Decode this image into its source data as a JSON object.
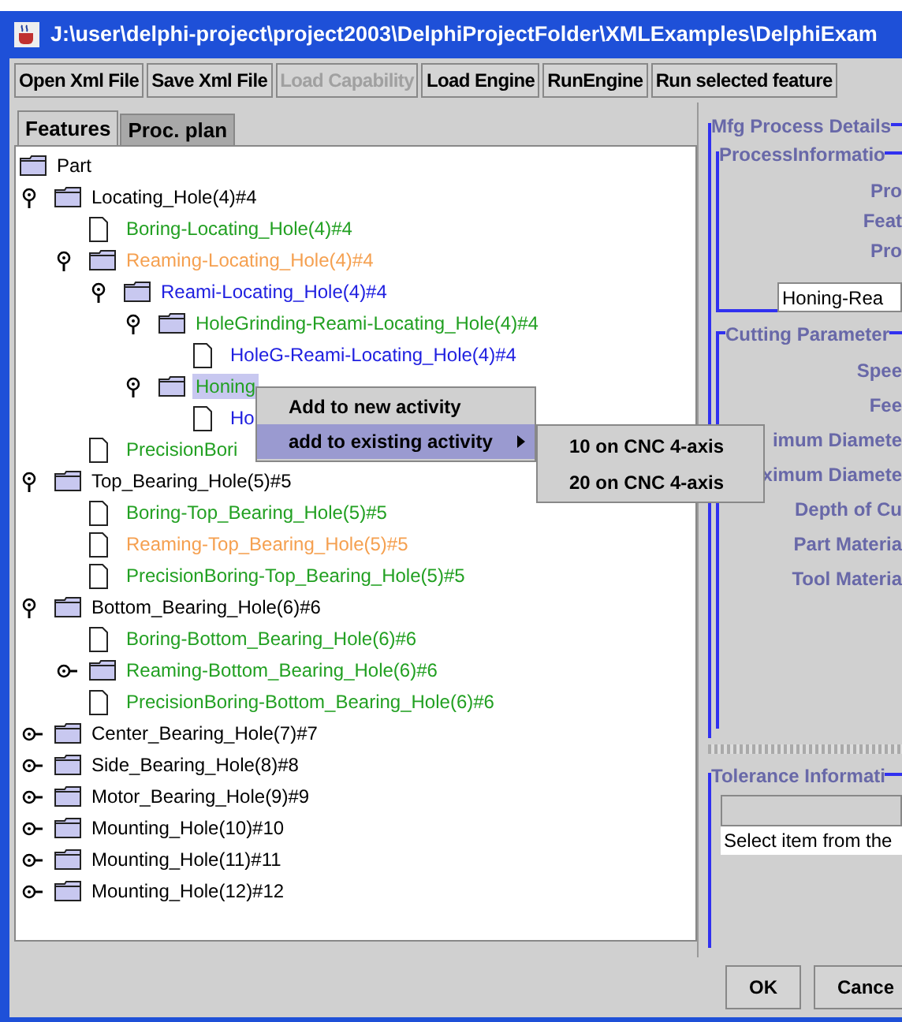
{
  "window": {
    "title": "J:\\user\\delphi-project\\project2003\\DelphiProjectFolder\\XMLExamples\\DelphiExam"
  },
  "toolbar": [
    {
      "label": "Open Xml File",
      "disabled": false
    },
    {
      "label": "Save Xml File",
      "disabled": false
    },
    {
      "label": "Load Capability",
      "disabled": true
    },
    {
      "label": "Load Engine",
      "disabled": false
    },
    {
      "label": "RunEngine",
      "disabled": false
    },
    {
      "label": "Run selected feature",
      "disabled": false
    }
  ],
  "tabs": [
    {
      "label": "Features",
      "selected": true
    },
    {
      "label": "Proc. plan",
      "selected": false
    }
  ],
  "tree": [
    {
      "label": "Part",
      "kind": "folder",
      "selected": false,
      "color": "#000000",
      "children": [
        {
          "label": "Locating_Hole(4)#4",
          "kind": "folder",
          "expanded": true,
          "selected": false,
          "color": "#000000",
          "children": [
            {
              "label": "Boring-Locating_Hole(4)#4",
              "kind": "file",
              "selected": false,
              "color": "#22a022"
            },
            {
              "label": "Reaming-Locating_Hole(4)#4",
              "kind": "folder",
              "expanded": true,
              "selected": false,
              "color": "#f5a050",
              "children": [
                {
                  "label": "Reami-Locating_Hole(4)#4",
                  "kind": "folder",
                  "expanded": true,
                  "selected": false,
                  "color": "#2020e0",
                  "children": [
                    {
                      "label": "HoleGrinding-Reami-Locating_Hole(4)#4",
                      "kind": "folder",
                      "expanded": true,
                      "selected": false,
                      "color": "#22a022",
                      "children": [
                        {
                          "label": "HoleG-Reami-Locating_Hole(4)#4",
                          "kind": "file",
                          "selected": false,
                          "color": "#2020e0"
                        }
                      ]
                    },
                    {
                      "label": "Honing",
                      "kind": "folder",
                      "expanded": true,
                      "selected": true,
                      "color": "#22a022",
                      "children": [
                        {
                          "label": "Ho",
                          "kind": "file",
                          "selected": false,
                          "color": "#2020e0"
                        }
                      ]
                    }
                  ]
                }
              ]
            },
            {
              "label": "PrecisionBori",
              "kind": "file",
              "selected": false,
              "color": "#22a022"
            }
          ]
        },
        {
          "label": "Top_Bearing_Hole(5)#5",
          "kind": "folder",
          "expanded": true,
          "selected": false,
          "color": "#000000",
          "children": [
            {
              "label": "Boring-Top_Bearing_Hole(5)#5",
              "kind": "file",
              "selected": false,
              "color": "#22a022"
            },
            {
              "label": "Reaming-Top_Bearing_Hole(5)#5",
              "kind": "file",
              "selected": false,
              "color": "#f5a050"
            },
            {
              "label": "PrecisionBoring-Top_Bearing_Hole(5)#5",
              "kind": "file",
              "selected": false,
              "color": "#22a022"
            }
          ]
        },
        {
          "label": "Bottom_Bearing_Hole(6)#6",
          "kind": "folder",
          "expanded": true,
          "selected": false,
          "color": "#000000",
          "children": [
            {
              "label": "Boring-Bottom_Bearing_Hole(6)#6",
              "kind": "file",
              "selected": false,
              "color": "#22a022"
            },
            {
              "label": "Reaming-Bottom_Bearing_Hole(6)#6",
              "kind": "folder",
              "expanded": false,
              "selected": false,
              "color": "#22a022"
            },
            {
              "label": "PrecisionBoring-Bottom_Bearing_Hole(6)#6",
              "kind": "file",
              "selected": false,
              "color": "#22a022"
            }
          ]
        },
        {
          "label": "Center_Bearing_Hole(7)#7",
          "kind": "folder",
          "expanded": false,
          "selected": false,
          "color": "#000000"
        },
        {
          "label": "Side_Bearing_Hole(8)#8",
          "kind": "folder",
          "expanded": false,
          "selected": false,
          "color": "#000000"
        },
        {
          "label": "Motor_Bearing_Hole(9)#9",
          "kind": "folder",
          "expanded": false,
          "selected": false,
          "color": "#000000"
        },
        {
          "label": "Mounting_Hole(10)#10",
          "kind": "folder",
          "expanded": false,
          "selected": false,
          "color": "#000000"
        },
        {
          "label": "Mounting_Hole(11)#11",
          "kind": "folder",
          "expanded": false,
          "selected": false,
          "color": "#000000"
        },
        {
          "label": "Mounting_Hole(12)#12",
          "kind": "folder",
          "expanded": false,
          "selected": false,
          "color": "#000000"
        }
      ]
    }
  ],
  "context_menu": [
    {
      "label": "Add to new activity",
      "selected": false,
      "submenu": false
    },
    {
      "label": "add to existing activity",
      "selected": true,
      "submenu": true
    }
  ],
  "submenu": [
    {
      "label": "10 on CNC 4-axis",
      "selected": false
    },
    {
      "label": "20 on CNC 4-axis",
      "selected": false
    }
  ],
  "details": {
    "title": "Mfg Process Details",
    "process_information": {
      "title": "ProcessInformatio",
      "labels": [
        "Pro",
        "Feat",
        "Pro"
      ],
      "value": "Honing-Rea"
    },
    "cutting_parameters": {
      "title": "Cutting Parameter",
      "labels": [
        "Spee",
        "Fee",
        "imum Diamete",
        "ximum Diamete",
        "Depth of Cu",
        "Part Materia",
        "Tool Materia"
      ]
    }
  },
  "tolerance": {
    "title": "Tolerance Informati",
    "row": "Select item from the"
  },
  "buttons": [
    "OK",
    "Cance"
  ]
}
